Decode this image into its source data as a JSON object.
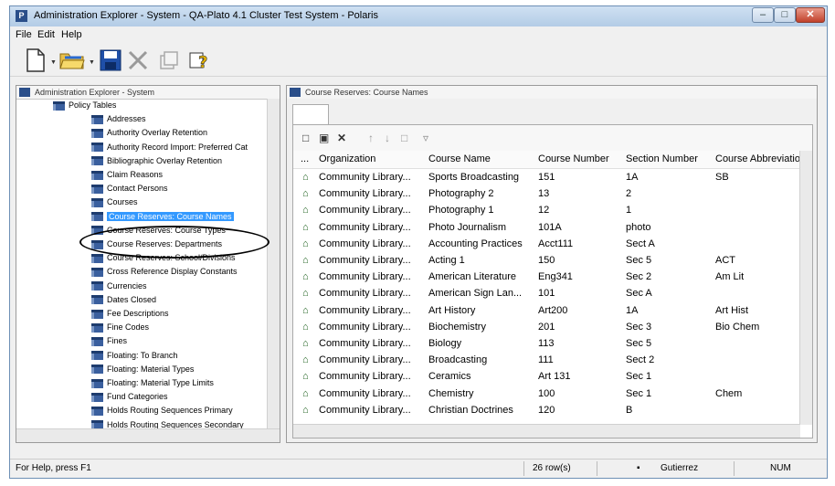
{
  "window": {
    "title": "Administration Explorer - System - QA-Plato 4.1 Cluster Test System - Polaris",
    "icon_name": "polaris-app-icon"
  },
  "menu": [
    "File",
    "Edit",
    "Help"
  ],
  "toolbar_icons": [
    "new-icon",
    "open-folder-icon",
    "save-icon",
    "delete-icon",
    "properties-icon",
    "help-icon"
  ],
  "left_pane": {
    "header": "Administration Explorer - System",
    "tree": [
      {
        "label": "Policy Tables",
        "level": 0
      },
      {
        "label": "Addresses",
        "level": 1
      },
      {
        "label": "Authority Overlay Retention",
        "level": 1
      },
      {
        "label": "Authority Record Import: Preferred Cat",
        "level": 1
      },
      {
        "label": "Bibliographic Overlay Retention",
        "level": 1
      },
      {
        "label": "Claim Reasons",
        "level": 1
      },
      {
        "label": "Contact Persons",
        "level": 1
      },
      {
        "label": "Courses",
        "level": 1
      },
      {
        "label": "Course Reserves: Course Names",
        "level": 1,
        "selected": true
      },
      {
        "label": "Course Reserves: Course Types",
        "level": 1
      },
      {
        "label": "Course Reserves: Departments",
        "level": 1
      },
      {
        "label": "Course Reserves: School/Divisions",
        "level": 1
      },
      {
        "label": "Cross Reference Display Constants",
        "level": 1
      },
      {
        "label": "Currencies",
        "level": 1
      },
      {
        "label": "Dates Closed",
        "level": 1
      },
      {
        "label": "Fee Descriptions",
        "level": 1
      },
      {
        "label": "Fine Codes",
        "level": 1
      },
      {
        "label": "Fines",
        "level": 1
      },
      {
        "label": "Floating: To Branch",
        "level": 1
      },
      {
        "label": "Floating: Material Types",
        "level": 1
      },
      {
        "label": "Floating: Material Type Limits",
        "level": 1
      },
      {
        "label": "Fund Categories",
        "level": 1
      },
      {
        "label": "Holds Routing Sequences Primary",
        "level": 1
      },
      {
        "label": "Holds Routing Sequences Secondary",
        "level": 1
      }
    ]
  },
  "right_pane": {
    "header": "Course Reserves: Course Names",
    "columns": [
      "...",
      "Organization",
      "Course Name",
      "Course Number",
      "Section Number",
      "Course Abbreviation"
    ],
    "rows": [
      [
        "Community Library...",
        "Sports Broadcasting",
        "151",
        "1A",
        "SB"
      ],
      [
        "Community Library...",
        "Photography 2",
        "13",
        "2",
        ""
      ],
      [
        "Community Library...",
        "Photography 1",
        "12",
        "1",
        ""
      ],
      [
        "Community Library...",
        "Photo Journalism",
        "101A",
        "photo",
        ""
      ],
      [
        "Community Library...",
        "Accounting Practices",
        "Acct111",
        "Sect A",
        ""
      ],
      [
        "Community Library...",
        "Acting 1",
        "150",
        "Sec 5",
        "ACT"
      ],
      [
        "Community Library...",
        "American Literature",
        "Eng341",
        "Sec 2",
        "Am Lit"
      ],
      [
        "Community Library...",
        "American Sign Lan...",
        "101",
        "Sec A",
        ""
      ],
      [
        "Community Library...",
        "Art History",
        "Art200",
        "1A",
        "Art Hist"
      ],
      [
        "Community Library...",
        "Biochemistry",
        "201",
        "Sec 3",
        "Bio Chem"
      ],
      [
        "Community Library...",
        "Biology",
        "113",
        "Sec 5",
        ""
      ],
      [
        "Community Library...",
        "Broadcasting",
        "111",
        "Sect 2",
        ""
      ],
      [
        "Community Library...",
        "Ceramics",
        "Art 131",
        "Sec 1",
        ""
      ],
      [
        "Community Library...",
        "Chemistry",
        "100",
        "Sec 1",
        "Chem"
      ],
      [
        "Community Library...",
        "Christian Doctrines",
        "120",
        "B",
        ""
      ]
    ]
  },
  "status": {
    "help": "For Help, press F1",
    "rows": "26 row(s)",
    "user": "Gutierrez",
    "num": "NUM"
  }
}
